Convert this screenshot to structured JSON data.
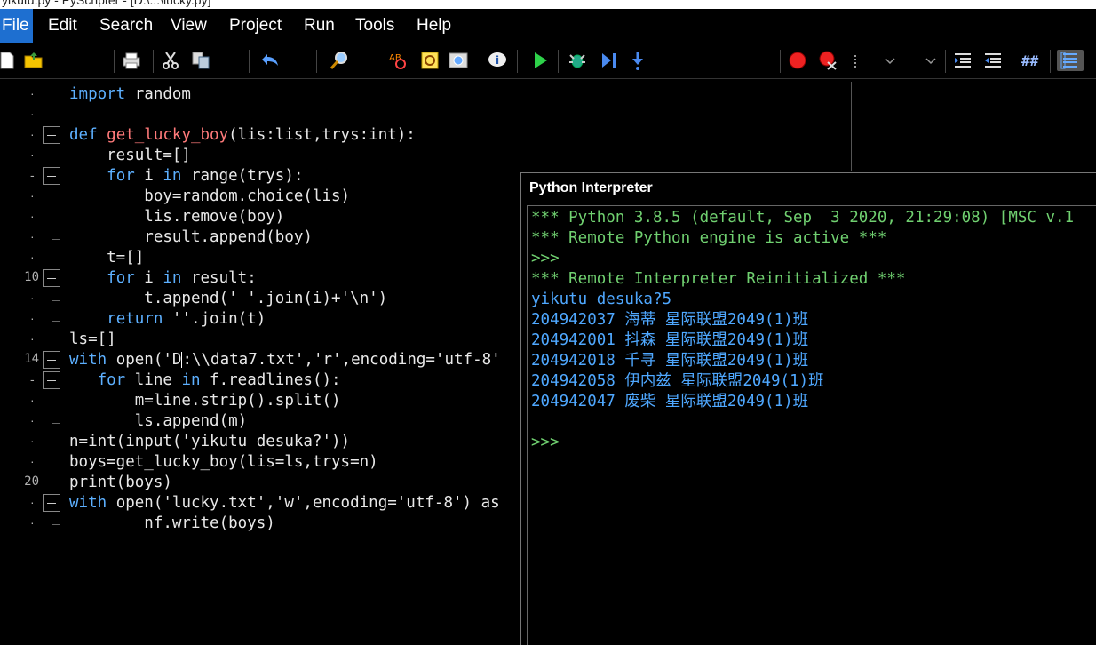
{
  "window": {
    "title_fragment": "yikutu.py - PyScripter - [D:\\...\\lucky.py]"
  },
  "menu": [
    "File",
    "Edit",
    "Search",
    "View",
    "Project",
    "Run",
    "Tools",
    "Help"
  ],
  "toolbar_icons": [
    "new-file-icon",
    "open-folder-icon",
    "print-icon",
    "cut-icon",
    "copy-icon",
    "undo-icon",
    "find-icon",
    "spell-icon",
    "highlight-icon",
    "screenshot-icon",
    "info-icon",
    "run-icon",
    "debug-icon",
    "step-icon",
    "step-into-icon",
    "breakpoint-icon",
    "clear-breakpoints-icon",
    "dropdown-icon",
    "dropdown-icon",
    "indent-icon",
    "dedent-icon",
    "comment-icon",
    "list-icon"
  ],
  "editor": {
    "line_numbers": {
      "l10": "10",
      "l14": "14",
      "l20": "20"
    },
    "lines": {
      "l1a": "import",
      "l1b": " random",
      "l3a": "def",
      "l3b": " ",
      "l3c": "get_lucky_boy",
      "l3d": "(lis:list,trys:int):",
      "l4": "    result=[]",
      "l5a": "    ",
      "l5b": "for",
      "l5c": " i ",
      "l5d": "in",
      "l5e": " range(trys):",
      "l6": "        boy=random.choice(lis)",
      "l7": "        lis.remove(boy)",
      "l8": "        result.append(boy)",
      "l9": "    t=[]",
      "l10a": "    ",
      "l10b": "for",
      "l10c": " i ",
      "l10d": "in",
      "l10e": " result:",
      "l11": "        t.append(' '.join(i)+'\\n')",
      "l12a": "    ",
      "l12b": "return",
      "l12c": " ''.join(t)",
      "l13": "ls=[]",
      "l14a": "with",
      "l14b": " open('D",
      "l14c": ":\\\\data7.txt','r',encoding='utf-8'",
      "l15a": "   ",
      "l15b": "for",
      "l15c": " line ",
      "l15d": "in",
      "l15e": " f.readlines():",
      "l16": "       m=line.strip().split()",
      "l17": "       ls.append(m)",
      "l18": "n=int(input('yikutu desuka?'))",
      "l19": "boys=get_lucky_boy(lis=ls,trys=n)",
      "l20": "print(boys)",
      "l21a": "with",
      "l21b": " open('lucky.txt','w',encoding='utf-8') as",
      "l22": "        nf.write(boys)"
    }
  },
  "interpreter": {
    "title": "Python Interpreter",
    "lines": [
      "*** Python 3.8.5 (default, Sep  3 2020, 21:29:08) [MSC v.1",
      "*** Remote Python engine is active ***",
      ">>>",
      "*** Remote Interpreter Reinitialized ***",
      "yikutu desuka?5",
      "204942037 海蒂 星际联盟2049(1)班",
      "204942001 抖森 星际联盟2049(1)班",
      "204942018 千寻 星际联盟2049(1)班",
      "204942058 伊内兹 星际联盟2049(1)班",
      "204942047 废柴 星际联盟2049(1)班",
      "",
      ">>>"
    ]
  },
  "colors": {
    "keyword": "#5db0ff",
    "function": "#ff7a7a",
    "prompt": "#70d070",
    "output": "#4fa8ff",
    "menu_active": "#1e6fd0"
  }
}
